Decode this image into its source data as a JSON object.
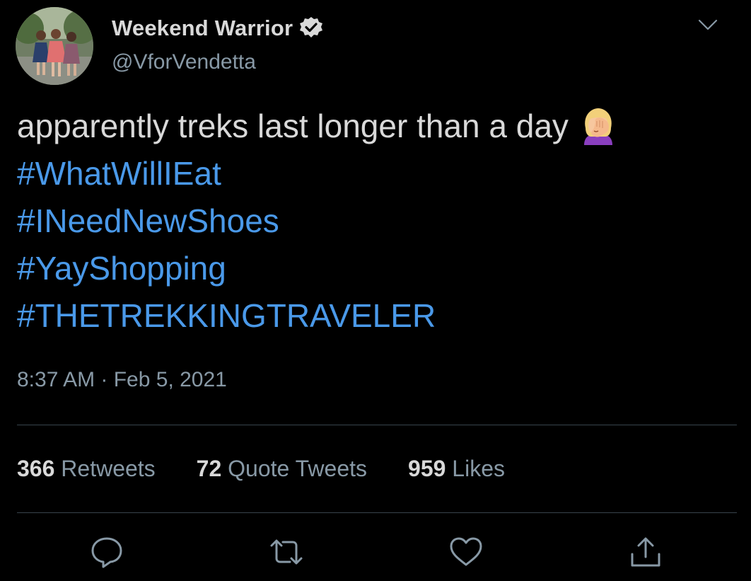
{
  "user": {
    "display_name": "Weekend Warrior",
    "handle": "@VforVendetta",
    "verified": true
  },
  "tweet": {
    "text": "apparently treks last longer than a day",
    "emoji": "woman-facepalming-emoji",
    "hashtags": [
      "#WhatWillIEat",
      "#INeedNewShoes",
      "#YayShopping",
      "#THETREKKINGTRAVELER"
    ],
    "timestamp": "8:37 AM · Feb 5, 2021"
  },
  "stats": [
    {
      "count": "366",
      "label": "Retweets"
    },
    {
      "count": "72",
      "label": "Quote Tweets"
    },
    {
      "count": "959",
      "label": "Likes"
    }
  ],
  "actions": [
    "reply-icon",
    "retweet-icon",
    "like-icon",
    "share-icon"
  ],
  "colors": {
    "background": "#000000",
    "text": "#d9d9d9",
    "secondary": "#8899a6",
    "link": "#4a99e9",
    "divider": "#38444d"
  }
}
